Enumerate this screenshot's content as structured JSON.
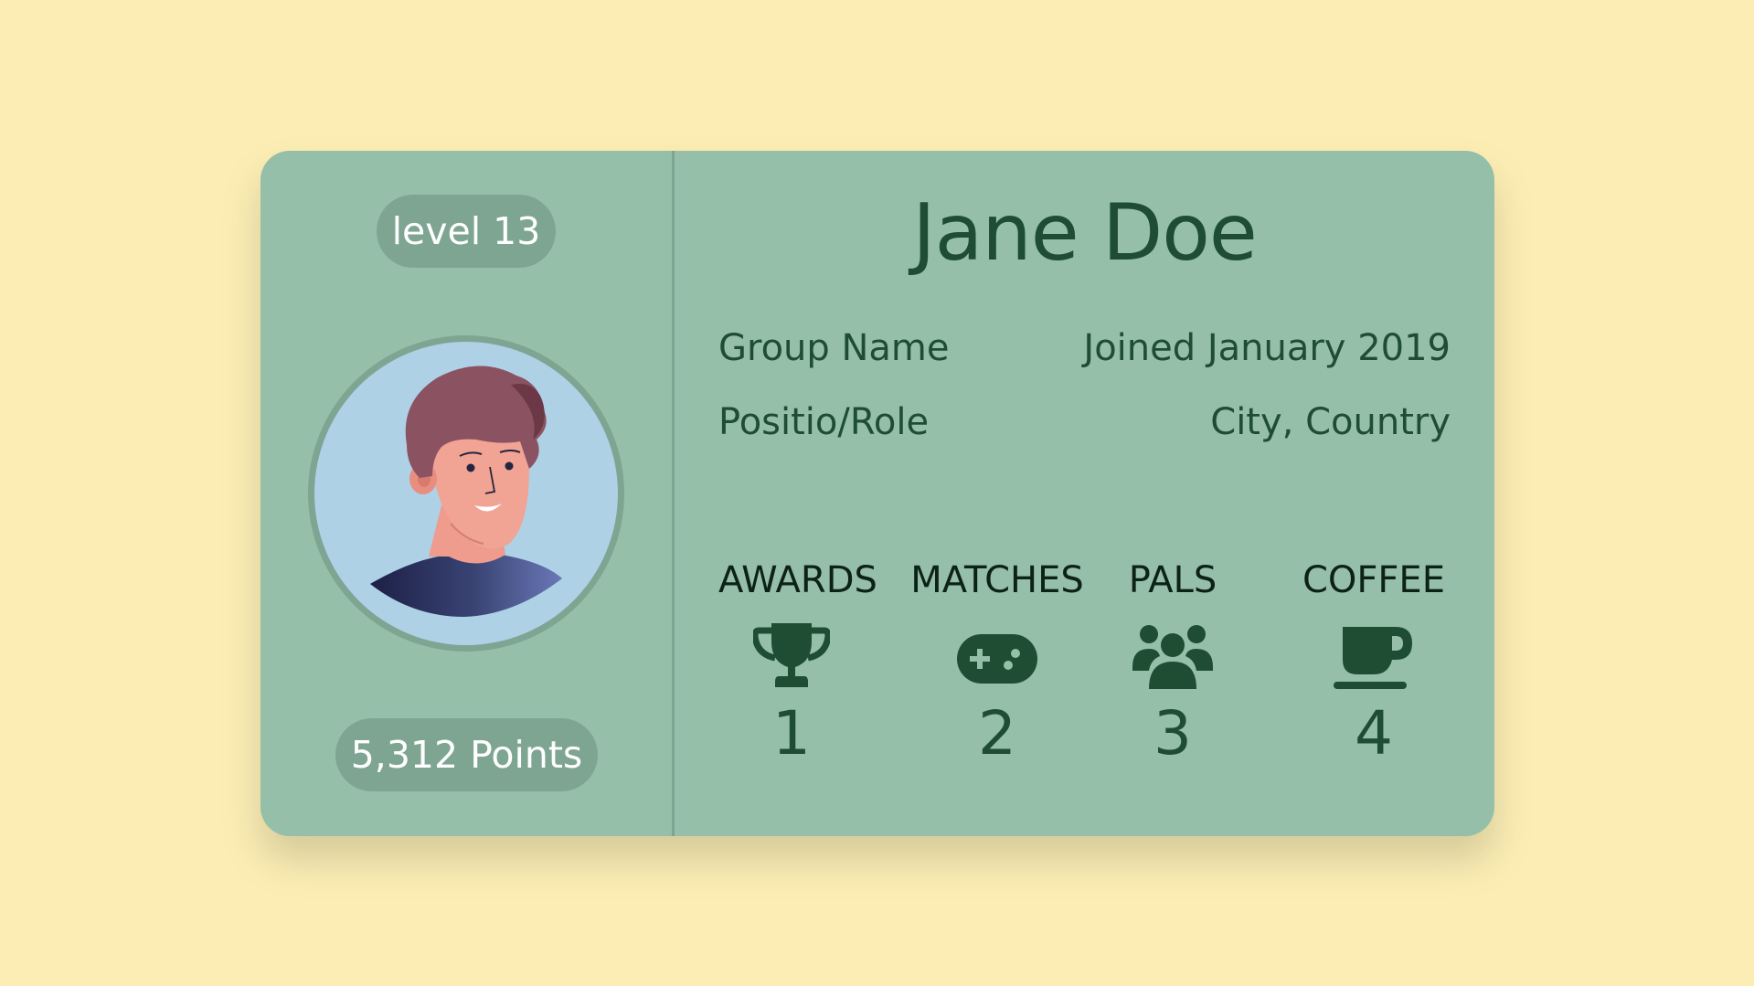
{
  "profile": {
    "level": "level 13",
    "points": "5,312 Points",
    "name": "Jane Doe",
    "group": "Group Name",
    "joined": "Joined January 2019",
    "role": "Positio/Role",
    "location": "City, Country"
  },
  "stats": [
    {
      "label": "AWARDS",
      "icon": "trophy-icon",
      "value": "1"
    },
    {
      "label": "MATCHES",
      "icon": "gamepad-icon",
      "value": "2"
    },
    {
      "label": "PALS",
      "icon": "users-icon",
      "value": "3"
    },
    {
      "label": "COFFEE",
      "icon": "coffee-icon",
      "value": "4"
    }
  ],
  "colors": {
    "background": "#fcedb4",
    "card": "#95bfa8",
    "accent": "#7ea592",
    "text": "#1e4d33"
  }
}
